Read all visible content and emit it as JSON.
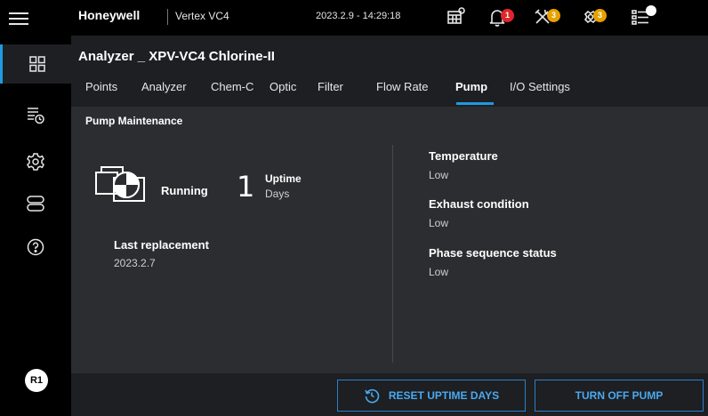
{
  "topbar": {
    "brand": "Honeywell",
    "product": "Vertex VC4",
    "datetime": "2023.2.9 - 14:29:18",
    "badges": {
      "alarms": "1",
      "maintenance": "3",
      "faults": "3"
    }
  },
  "nav": {
    "user_initials": "R1"
  },
  "header": {
    "title": "Analyzer _ XPV-VC4 Chlorine-II",
    "tabs": [
      "Points",
      "Analyzer",
      "Chem-C",
      "Optic",
      "Filter",
      "Flow Rate",
      "Pump",
      "I/O Settings"
    ],
    "active_tab": "Pump"
  },
  "pump": {
    "section_title": "Pump Maintenance",
    "status": "Running",
    "uptime_value": "1",
    "uptime_label": "Uptime",
    "uptime_unit": "Days",
    "last_replacement_label": "Last replacement",
    "last_replacement_value": "2023.2.7",
    "stats": [
      {
        "label": "Temperature",
        "value": "Low"
      },
      {
        "label": "Exhaust condition",
        "value": "Low"
      },
      {
        "label": "Phase sequence status",
        "value": "Low"
      }
    ]
  },
  "footer": {
    "reset_label": "RESET UPTIME DAYS",
    "turn_off_label": "TURN OFF PUMP"
  },
  "colors": {
    "accent": "#1e9be0",
    "badge_red": "#e0262b",
    "badge_amber": "#e6a100"
  }
}
